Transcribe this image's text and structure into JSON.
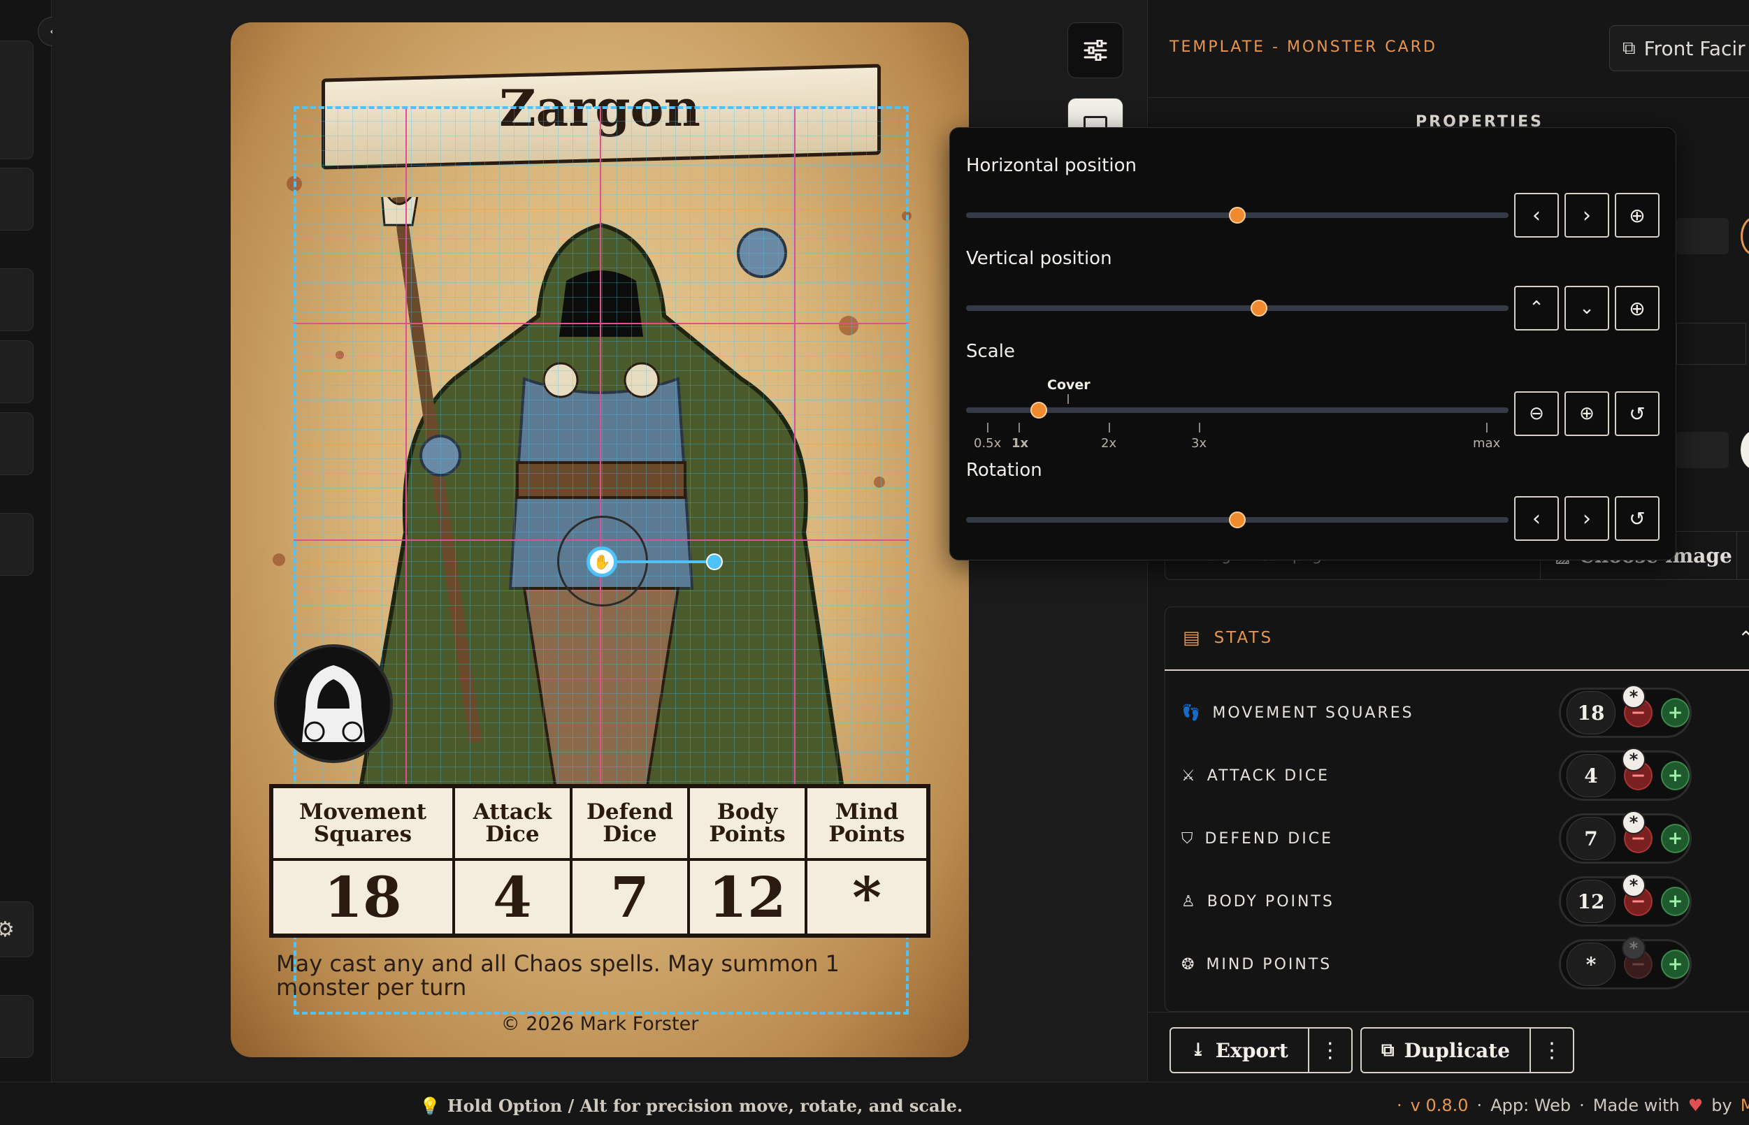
{
  "card": {
    "title": "Zargon",
    "stats": [
      {
        "label": "Movement\nSquares",
        "value": "18"
      },
      {
        "label": "Attack\nDice",
        "value": "4"
      },
      {
        "label": "Defend\nDice",
        "value": "7"
      },
      {
        "label": "Body\nPoints",
        "value": "12"
      },
      {
        "label": "Mind\nPoints",
        "value": "*"
      }
    ],
    "description": "May cast any and all Chaos spells. May summon 1 monster per turn",
    "copyright": "© 2026 Mark Forster"
  },
  "panel": {
    "template_label": "TEMPLATE - MONSTER CARD",
    "front_facing_label": "Front Facir",
    "properties_label": "PROPERTIES",
    "image_filename": "zargon-icon.png",
    "choose_image_label": "Choose image",
    "stats_title": "STATS",
    "stat_rows": [
      {
        "label": "MOVEMENT SQUARES",
        "value": "18",
        "icon": "footprints-icon",
        "minus_enabled": true
      },
      {
        "label": "ATTACK DICE",
        "value": "4",
        "icon": "swords-icon",
        "minus_enabled": true
      },
      {
        "label": "DEFEND DICE",
        "value": "7",
        "icon": "shield-icon",
        "minus_enabled": true
      },
      {
        "label": "BODY POINTS",
        "value": "12",
        "icon": "person-icon",
        "minus_enabled": true
      },
      {
        "label": "MIND POINTS",
        "value": "*",
        "icon": "brain-icon",
        "minus_enabled": false
      }
    ],
    "export_label": "Export",
    "duplicate_label": "Duplicate"
  },
  "popover": {
    "horizontal_label": "Horizontal position",
    "horizontal_value": 0.5,
    "vertical_label": "Vertical position",
    "vertical_value": 0.54,
    "scale_label": "Scale",
    "scale_cover_label": "Cover",
    "scale_ticks": [
      "0.5x",
      "1x",
      "2x",
      "3x",
      "max"
    ],
    "rotation_label": "Rotation",
    "rotation_value": 0.5
  },
  "statusbar": {
    "hint": "Hold Option / Alt for precision move, rotate, and scale.",
    "version": "v 0.8.0",
    "app": "App: Web",
    "made_with": "Made with",
    "by": "by",
    "author": "Mark Fo"
  },
  "colors": {
    "accent": "#e7964c",
    "guide": "#4fc3f7",
    "slider_thumb": "#f08a2e"
  }
}
